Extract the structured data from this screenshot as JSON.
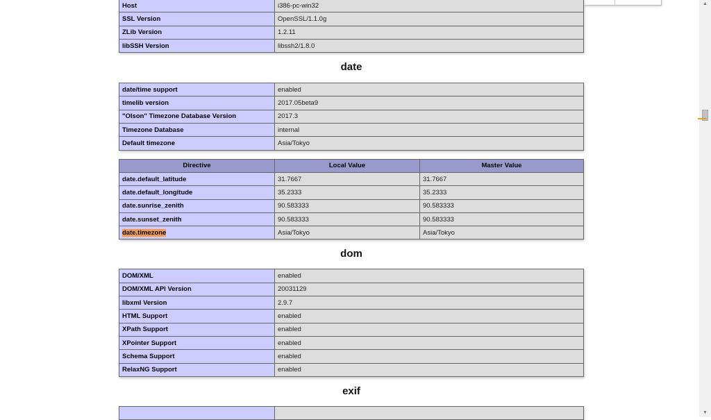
{
  "curl_tail": [
    {
      "label": "Host",
      "value": "i386-pc-win32"
    },
    {
      "label": "SSL Version",
      "value": "OpenSSL/1.1.0g"
    },
    {
      "label": "ZLib Version",
      "value": "1.2.11"
    },
    {
      "label": "libSSH Version",
      "value": "libssh2/1.8.0"
    }
  ],
  "date": {
    "title": "date",
    "info": [
      {
        "label": "date/time support",
        "value": "enabled"
      },
      {
        "label": "timelib version",
        "value": "2017.05beta9"
      },
      {
        "label": "\"Olson\" Timezone Database Version",
        "value": "2017.3"
      },
      {
        "label": "Timezone Database",
        "value": "internal"
      },
      {
        "label": "Default timezone",
        "value": "Asia/Tokyo"
      }
    ],
    "directive_headers": {
      "directive": "Directive",
      "local": "Local Value",
      "master": "Master Value"
    },
    "directives": [
      {
        "name": "date.default_latitude",
        "local": "31.7667",
        "master": "31.7667"
      },
      {
        "name": "date.default_longitude",
        "local": "35.2333",
        "master": "35.2333"
      },
      {
        "name": "date.sunrise_zenith",
        "local": "90.583333",
        "master": "90.583333"
      },
      {
        "name": "date.sunset_zenith",
        "local": "90.583333",
        "master": "90.583333"
      },
      {
        "name": "date.timezone",
        "local": "Asia/Tokyo",
        "master": "Asia/Tokyo",
        "highlighted": true
      }
    ]
  },
  "dom": {
    "title": "dom",
    "info": [
      {
        "label": "DOM/XML",
        "value": "enabled"
      },
      {
        "label": "DOM/XML API Version",
        "value": "20031129"
      },
      {
        "label": "libxml Version",
        "value": "2.9.7"
      },
      {
        "label": "HTML Support",
        "value": "enabled"
      },
      {
        "label": "XPath Support",
        "value": "enabled"
      },
      {
        "label": "XPointer Support",
        "value": "enabled"
      },
      {
        "label": "Schema Support",
        "value": "enabled"
      },
      {
        "label": "RelaxNG Support",
        "value": "enabled"
      }
    ]
  },
  "exif": {
    "title": "exif"
  },
  "colors": {
    "header": "#9999cc",
    "label_cell": "#ccccff",
    "value_cell": "#dddddd",
    "search_highlight": "#f29a45"
  },
  "icons": {
    "scroll_up": "triangle-up",
    "scroll_down": "triangle-down"
  }
}
